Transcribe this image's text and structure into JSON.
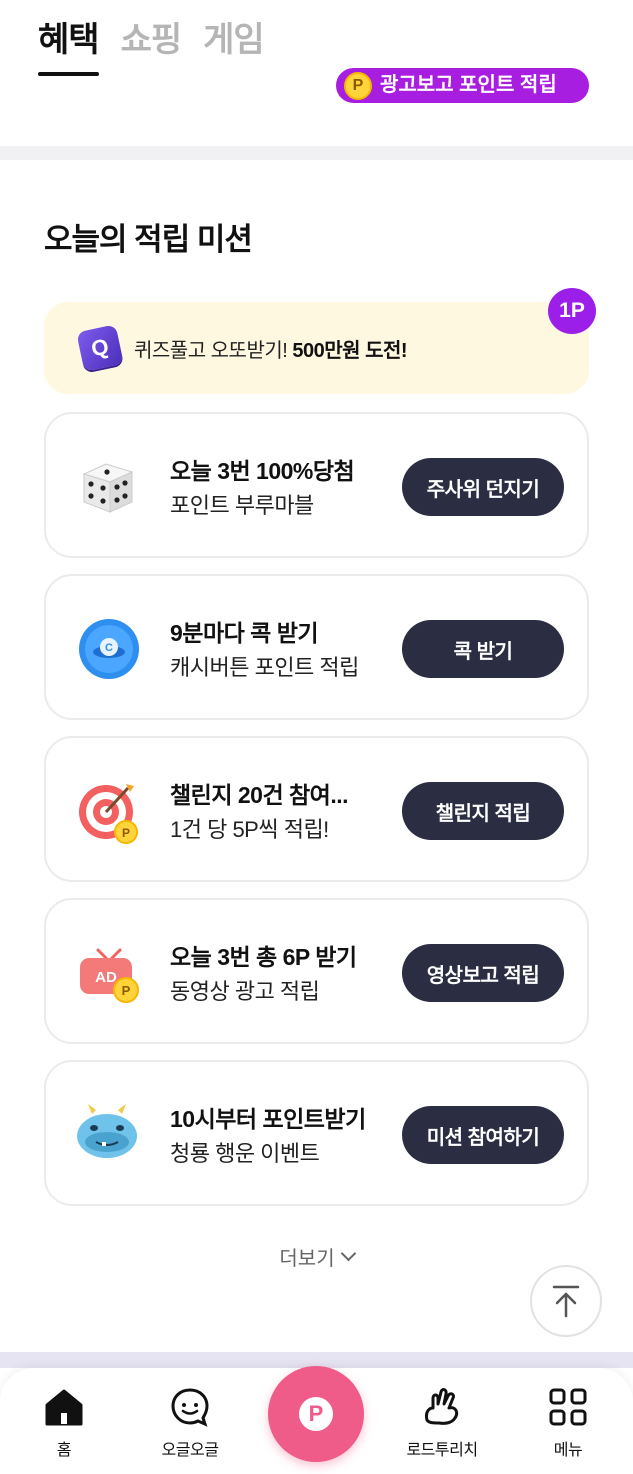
{
  "top_tabs": [
    {
      "label": "혜택",
      "active": true
    },
    {
      "label": "쇼핑",
      "active": false
    },
    {
      "label": "게임",
      "active": false
    }
  ],
  "ad_pill": {
    "coin": "P",
    "label": "광고보고 포인트 적립"
  },
  "missions": {
    "title": "오늘의 적립 미션",
    "quiz_banner": {
      "icon_letter": "Q",
      "text": "퀴즈풀고 오또받기! ",
      "highlight": "500만원 도전!",
      "badge": "1P"
    },
    "cards": [
      {
        "title": "오늘 3번 100%당첨",
        "subtitle": "포인트 부루마블",
        "button": "주사위 던지기",
        "icon": "dice-icon"
      },
      {
        "title": "9분마다 콕 받기",
        "subtitle": "캐시버튼 포인트 적립",
        "button": "콕 받기",
        "icon": "cash-button-icon"
      },
      {
        "title": "챌린지 20건 참여...",
        "subtitle": "1건 당 5P씩 적립!",
        "button": "챌린지 적립",
        "icon": "target-icon"
      },
      {
        "title": "오늘 3번 총 6P 받기",
        "subtitle": "동영상 광고 적립",
        "button": "영상보고 적립",
        "icon": "ad-tv-icon",
        "icon_text": "AD"
      },
      {
        "title": "10시부터 포인트받기",
        "subtitle": "청룡 행운 이벤트",
        "button": "미션 참여하기",
        "icon": "blue-dragon-icon"
      }
    ],
    "more_label": "더보기"
  },
  "bottom_nav": [
    {
      "label": "홈",
      "icon": "home-icon"
    },
    {
      "label": "오글오글",
      "icon": "chat-smile-icon"
    },
    {
      "label": "P",
      "icon": "point-center-icon"
    },
    {
      "label": "로드투리치",
      "icon": "road-hand-icon"
    },
    {
      "label": "메뉴",
      "icon": "grid-menu-icon"
    }
  ],
  "colors": {
    "accent_purple": "#a81ee0",
    "button_dark": "#2b2d42",
    "point_pink": "#f05c8a",
    "banner_bg": "#fff8e1"
  }
}
